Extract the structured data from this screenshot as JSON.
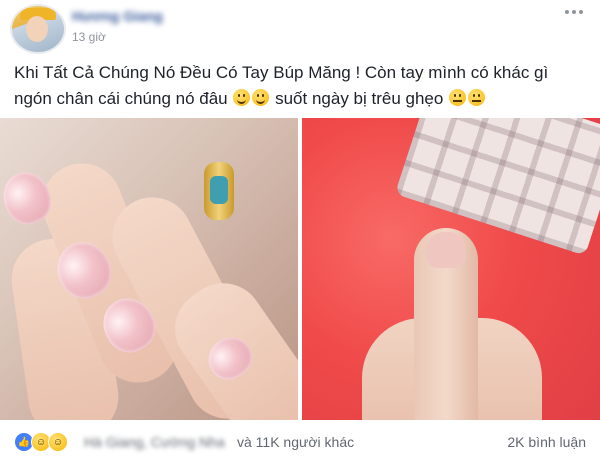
{
  "header": {
    "author_name": "Hương Giang",
    "time": "13 giờ"
  },
  "post": {
    "text_part1": "Khi Tất Cả Chúng Nó Đều Có Tay Búp Măng ! Còn tay mình có khác gì ngón chân cái chúng nó đâu",
    "text_part2": "suốt ngày bị trêu ghẹo"
  },
  "footer": {
    "reaction_names": "Hà Giang, Cường Nha",
    "others": "và 11K người khác",
    "comments": "2K bình luận"
  },
  "colors": {
    "link": "#365899",
    "meta": "#90949c",
    "like": "#4080ff"
  }
}
